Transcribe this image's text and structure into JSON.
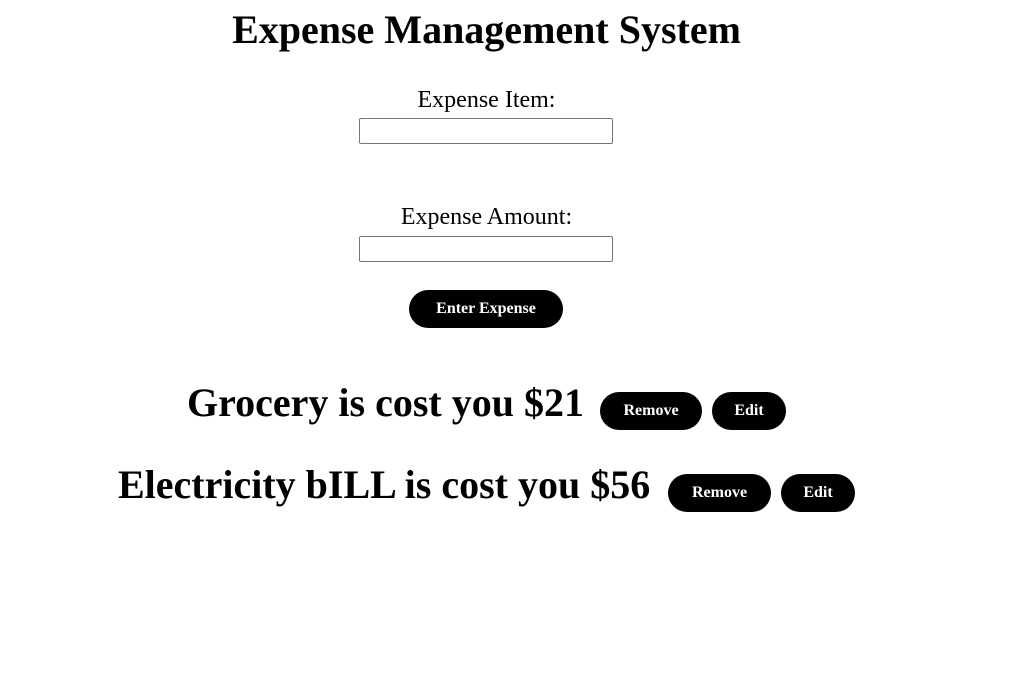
{
  "page": {
    "title": "Expense Management System"
  },
  "form": {
    "item_label": "Expense Item:",
    "item_value": "",
    "amount_label": "Expense Amount:",
    "amount_value": "",
    "submit_label": "Enter Expense"
  },
  "expenses": [
    {
      "text": "Grocery is cost you $21",
      "remove_label": "Remove",
      "edit_label": "Edit"
    },
    {
      "text": "Electricity bILL is cost you $56",
      "remove_label": "Remove",
      "edit_label": "Edit"
    }
  ],
  "colors": {
    "button_bg": "#000000",
    "button_text": "#ffffff",
    "page_bg": "#ffffff"
  }
}
